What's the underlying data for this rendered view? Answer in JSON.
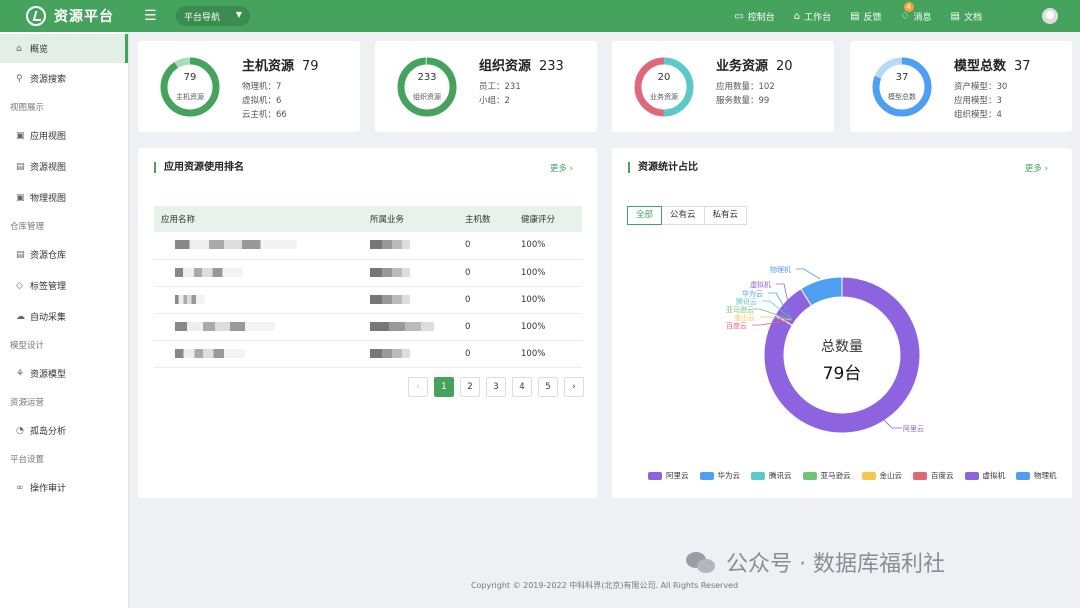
{
  "app": {
    "title": "资源平台"
  },
  "topbar": {
    "nav_select": "平台导航",
    "items": [
      {
        "icon": "monitor-icon",
        "glyph": "▭",
        "label": "控制台"
      },
      {
        "icon": "home-icon",
        "glyph": "⌂",
        "label": "工作台"
      },
      {
        "icon": "document-icon",
        "glyph": "▤",
        "label": "反馈"
      },
      {
        "icon": "bell-icon",
        "glyph": "♢",
        "label": "消息",
        "badge": "4"
      },
      {
        "icon": "file-icon",
        "glyph": "▤",
        "label": "文档"
      }
    ]
  },
  "sidebar": {
    "overview": "概览",
    "search": "资源搜索",
    "group_view": "视图展示",
    "app_view": "应用视图",
    "resource_view": "资源视图",
    "physical_view": "物理视图",
    "group_repo": "仓库管理",
    "resource_repo": "资源仓库",
    "tag_mgmt": "标签管理",
    "auto_collect": "自动采集",
    "group_model": "模型设计",
    "resource_model": "资源模型",
    "group_ops": "资源运营",
    "island_analysis": "孤岛分析",
    "group_settings": "平台设置",
    "audit": "操作审计"
  },
  "stats": [
    {
      "title": "主机资源",
      "value": "79",
      "ring_value": "79",
      "ring_label": "主机资源",
      "lines": [
        "物理机：7",
        "虚拟机：6",
        "云主机：66"
      ],
      "segments": [
        {
          "frac": 0.91,
          "color": "#46a35e"
        },
        {
          "frac": 0.09,
          "color": "#a8dcb8"
        }
      ]
    },
    {
      "title": "组织资源",
      "value": "233",
      "ring_value": "233",
      "ring_label": "组织资源",
      "lines": [
        "员工：231",
        "小组：2"
      ],
      "segments": [
        {
          "frac": 0.99,
          "color": "#46a35e"
        },
        {
          "frac": 0.01,
          "color": "#a8dcb8"
        }
      ]
    },
    {
      "title": "业务资源",
      "value": "20",
      "ring_value": "20",
      "ring_label": "业务资源",
      "lines": [
        "应用数量：102",
        "服务数量：99"
      ],
      "segments": [
        {
          "frac": 0.5,
          "color": "#5cc8c8"
        },
        {
          "frac": 0.5,
          "color": "#e0687c"
        }
      ]
    },
    {
      "title": "模型总数",
      "value": "37",
      "ring_value": "37",
      "ring_label": "模型总数",
      "lines": [
        "资产模型：30",
        "应用模型：3",
        "组织模型：4"
      ],
      "segments": [
        {
          "frac": 0.81,
          "color": "#4e9ef2"
        },
        {
          "frac": 0.19,
          "color": "#b9d9fa"
        }
      ]
    }
  ],
  "ranking": {
    "title": "应用资源使用排名",
    "more": "更多",
    "columns": [
      "应用名称",
      "所属业务",
      "主机数",
      "健康评分"
    ],
    "rows": [
      {
        "hosts": "0",
        "score": "100%"
      },
      {
        "hosts": "0",
        "score": "100%"
      },
      {
        "hosts": "0",
        "score": "100%"
      },
      {
        "hosts": "0",
        "score": "100%"
      },
      {
        "hosts": "0",
        "score": "100%"
      }
    ],
    "pages": [
      "1",
      "2",
      "3",
      "4",
      "5"
    ],
    "prev": "‹",
    "next": "›"
  },
  "ratio": {
    "title": "资源统计占比",
    "more": "更多",
    "tabs": [
      "全部",
      "公有云",
      "私有云"
    ],
    "center_label": "总数量",
    "center_value": "79台"
  },
  "chart_data": {
    "type": "pie",
    "categories": [
      "阿里云",
      "华为云",
      "腾讯云",
      "亚马逊云",
      "金山云",
      "百度云",
      "虚拟机",
      "物理机"
    ],
    "values": [
      66,
      0,
      0,
      0,
      0,
      0,
      6,
      7
    ],
    "colors": [
      "#8e63e0",
      "#4e9ef2",
      "#5cc8c8",
      "#6fc477",
      "#f2c94c",
      "#e0687c",
      "#8e63e0",
      "#4e9ef2"
    ],
    "legend": "bottom"
  },
  "footer": "Copyright © 2019-2022 中科科界(北京)有限公司. All Rights Reserved",
  "watermark": "公众号 · 数据库福利社"
}
